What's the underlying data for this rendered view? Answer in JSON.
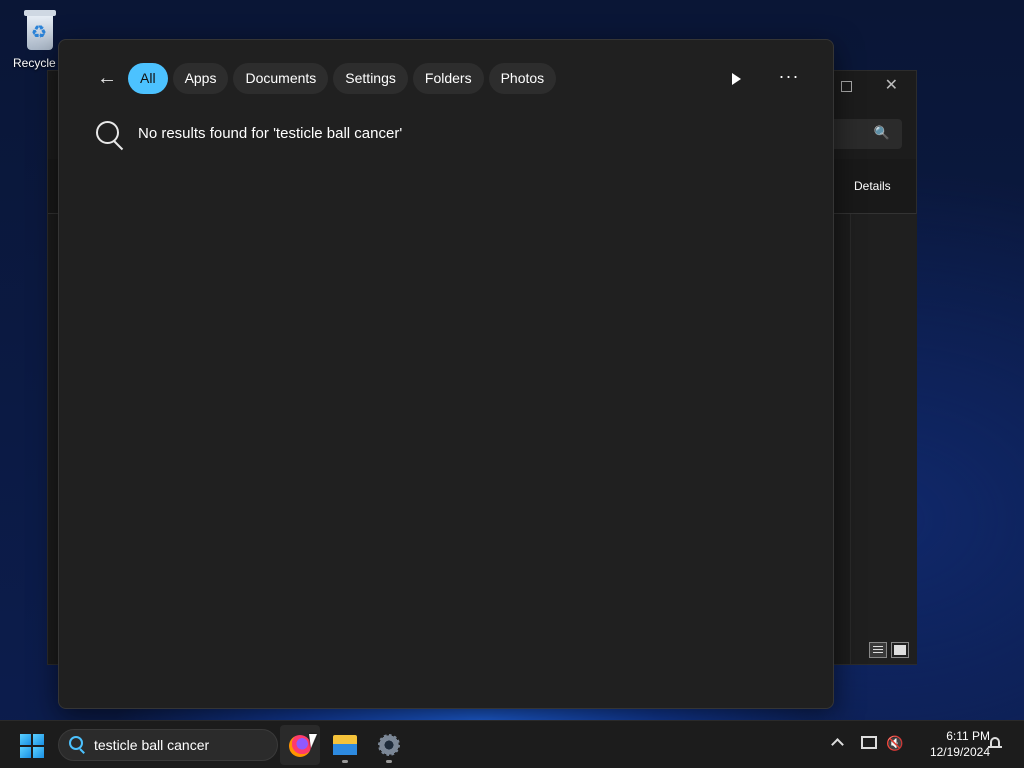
{
  "desktop": {
    "recycle_bin_label": "Recycle B"
  },
  "background_window": {
    "details_label": "Details",
    "close_glyph": "✕",
    "search_glyph": "🔍"
  },
  "search_flyout": {
    "back_glyph": "←",
    "tabs": [
      {
        "label": "All",
        "active": true
      },
      {
        "label": "Apps"
      },
      {
        "label": "Documents"
      },
      {
        "label": "Settings"
      },
      {
        "label": "Folders"
      },
      {
        "label": "Photos"
      }
    ],
    "more_glyph": "···",
    "no_results_message": "No results found for 'testicle ball cancer'"
  },
  "taskbar": {
    "search_query": "testicle ball cancer",
    "apps": [
      "firefox-icon",
      "file-explorer-icon",
      "settings-icon"
    ],
    "volume_glyph": "🔇",
    "clock_time": "6:11 PM",
    "clock_date": "12/19/2024"
  },
  "colors": {
    "accent": "#4cc2ff",
    "flyout_bg": "#202020",
    "taskbar_bg": "#1c1c1c"
  }
}
